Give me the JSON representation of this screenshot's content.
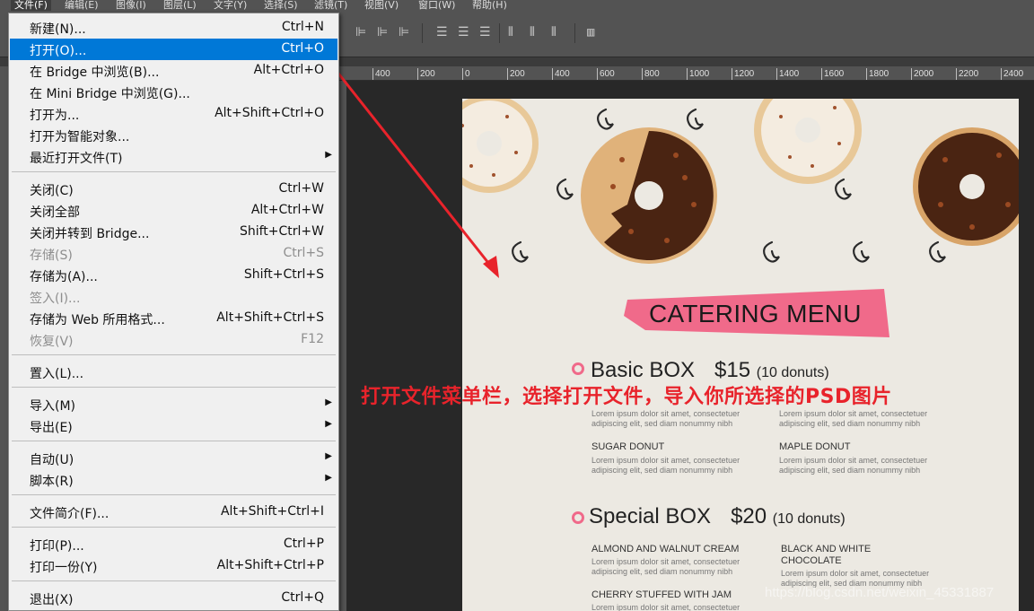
{
  "menubar": {
    "items": [
      "文件(F)",
      "编辑(E)",
      "图像(I)",
      "图层(L)",
      "文字(Y)",
      "选择(S)",
      "滤镜(T)",
      "视图(V)",
      "窗口(W)",
      "帮助(H)"
    ]
  },
  "ruler": {
    "ticks": [
      "400",
      "200",
      "0",
      "200",
      "400",
      "600",
      "800",
      "1000",
      "1200",
      "1400",
      "1600",
      "1800",
      "2000",
      "2200",
      "2400"
    ]
  },
  "file_menu": {
    "items": [
      {
        "label": "新建(N)...",
        "shortcut": "Ctrl+N"
      },
      {
        "label": "打开(O)...",
        "shortcut": "Ctrl+O"
      },
      {
        "label": "在 Bridge 中浏览(B)...",
        "shortcut": "Alt+Ctrl+O"
      },
      {
        "label": "在 Mini Bridge 中浏览(G)...",
        "shortcut": ""
      },
      {
        "label": "打开为...",
        "shortcut": "Alt+Shift+Ctrl+O"
      },
      {
        "label": "打开为智能对象...",
        "shortcut": ""
      },
      {
        "label": "最近打开文件(T)",
        "shortcut": ""
      },
      {
        "label": "关闭(C)",
        "shortcut": "Ctrl+W"
      },
      {
        "label": "关闭全部",
        "shortcut": "Alt+Ctrl+W"
      },
      {
        "label": "关闭并转到 Bridge...",
        "shortcut": "Shift+Ctrl+W"
      },
      {
        "label": "存储(S)",
        "shortcut": "Ctrl+S"
      },
      {
        "label": "存储为(A)...",
        "shortcut": "Shift+Ctrl+S"
      },
      {
        "label": "签入(I)...",
        "shortcut": ""
      },
      {
        "label": "存储为 Web 所用格式...",
        "shortcut": "Alt+Shift+Ctrl+S"
      },
      {
        "label": "恢复(V)",
        "shortcut": "F12"
      },
      {
        "label": "置入(L)...",
        "shortcut": ""
      },
      {
        "label": "导入(M)",
        "shortcut": ""
      },
      {
        "label": "导出(E)",
        "shortcut": ""
      },
      {
        "label": "自动(U)",
        "shortcut": ""
      },
      {
        "label": "脚本(R)",
        "shortcut": ""
      },
      {
        "label": "文件简介(F)...",
        "shortcut": "Alt+Shift+Ctrl+I"
      },
      {
        "label": "打印(P)...",
        "shortcut": "Ctrl+P"
      },
      {
        "label": "打印一份(Y)",
        "shortcut": "Alt+Shift+Ctrl+P"
      },
      {
        "label": "退出(X)",
        "shortcut": "Ctrl+Q"
      }
    ]
  },
  "annotation": "打开文件菜单栏，选择打开文件，导入你所选择的PSD图片",
  "poster": {
    "banner": "CATERING MENU",
    "boxes": [
      {
        "name": "Basic BOX",
        "price": "$15",
        "count": "(10 donuts)",
        "items": [
          {
            "name": "",
            "desc": "Lorem ipsum dolor sit amet, consectetuer adipiscing elit, sed diam nonummy nibh"
          },
          {
            "name": "",
            "desc": "Lorem ipsum dolor sit amet, consectetuer adipiscing elit, sed diam nonummy nibh"
          },
          {
            "name": "SUGAR DONUT",
            "desc": "Lorem ipsum dolor sit amet, consectetuer adipiscing elit, sed diam nonummy nibh"
          },
          {
            "name": "MAPLE DONUT",
            "desc": "Lorem ipsum dolor sit amet, consectetuer adipiscing elit, sed diam nonummy nibh"
          }
        ]
      },
      {
        "name": "Special BOX",
        "price": "$20",
        "count": "(10 donuts)",
        "items": [
          {
            "name": "ALMOND AND WALNUT CREAM",
            "desc": "Lorem ipsum dolor sit amet, consectetuer adipiscing elit, sed diam nonummy nibh"
          },
          {
            "name": "BLACK AND WHITE CHOCOLATE",
            "desc": "Lorem ipsum dolor sit amet, consectetuer adipiscing elit, sed diam nonummy nibh"
          },
          {
            "name": "CHERRY STUFFED WITH JAM",
            "desc": "Lorem ipsum dolor sit amet, consectetuer"
          }
        ]
      }
    ]
  },
  "watermark": "https://blog.csdn.net/weixin_45331887",
  "colors": {
    "menu_highlight": "#0078d7",
    "annotation": "#e8232b",
    "banner": "#f06a8a"
  }
}
